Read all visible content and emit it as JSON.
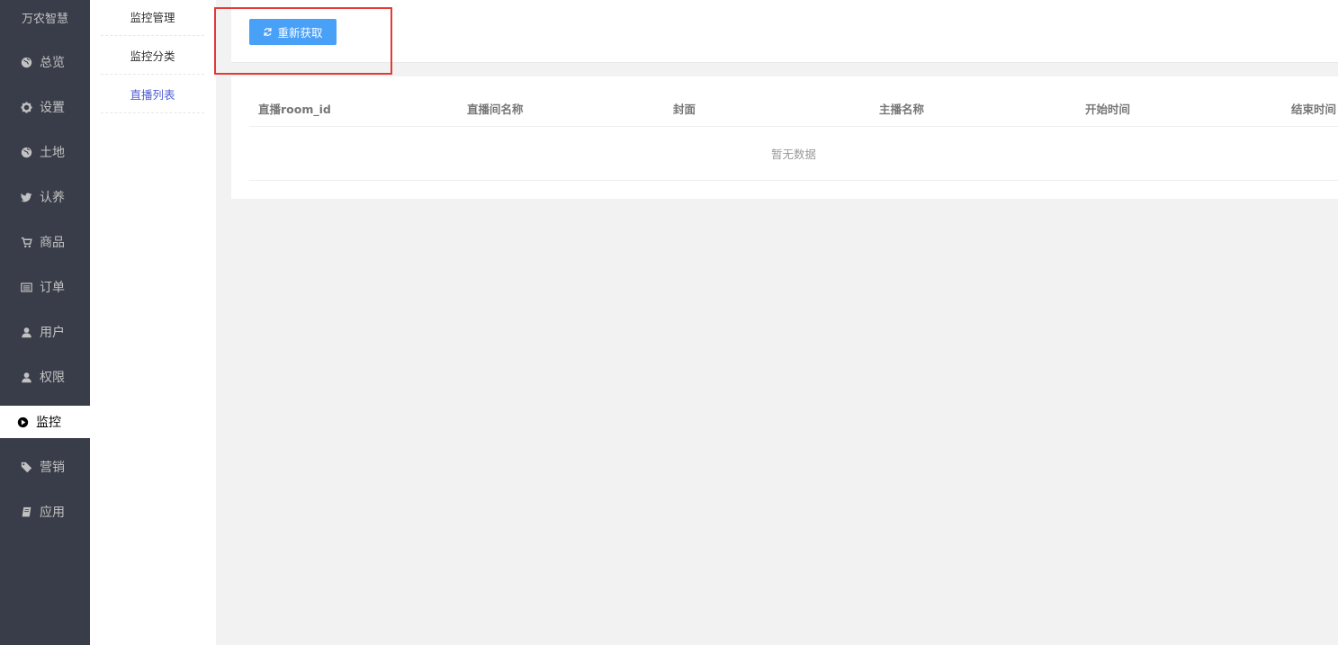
{
  "sidebar": {
    "brand": "万农智慧",
    "items": [
      {
        "label": "总览",
        "icon": "globe-icon"
      },
      {
        "label": "设置",
        "icon": "gear-icon"
      },
      {
        "label": "土地",
        "icon": "globe-icon"
      },
      {
        "label": "认养",
        "icon": "bird-icon"
      },
      {
        "label": "商品",
        "icon": "cart-icon"
      },
      {
        "label": "订单",
        "icon": "list-icon"
      },
      {
        "label": "用户",
        "icon": "user-icon"
      },
      {
        "label": "权限",
        "icon": "user-icon"
      },
      {
        "label": "监控",
        "icon": "play-circle-icon",
        "active": true
      },
      {
        "label": "营销",
        "icon": "tags-icon"
      },
      {
        "label": "应用",
        "icon": "book-icon"
      }
    ]
  },
  "subnav": {
    "items": [
      {
        "label": "监控管理"
      },
      {
        "label": "监控分类"
      },
      {
        "label": "直播列表",
        "active": true
      }
    ]
  },
  "toolbar": {
    "refresh_label": "重新获取",
    "refresh_icon": "refresh-icon",
    "button_color": "#49a0f7"
  },
  "table": {
    "columns": [
      "直播room_id",
      "直播间名称",
      "封面",
      "主播名称",
      "开始时间",
      "结束时间"
    ],
    "empty_text": "暂无数据"
  },
  "colors": {
    "sidebar_bg": "#393d49",
    "active_sub_text": "#4e5fd5",
    "highlight": "#e53935"
  }
}
